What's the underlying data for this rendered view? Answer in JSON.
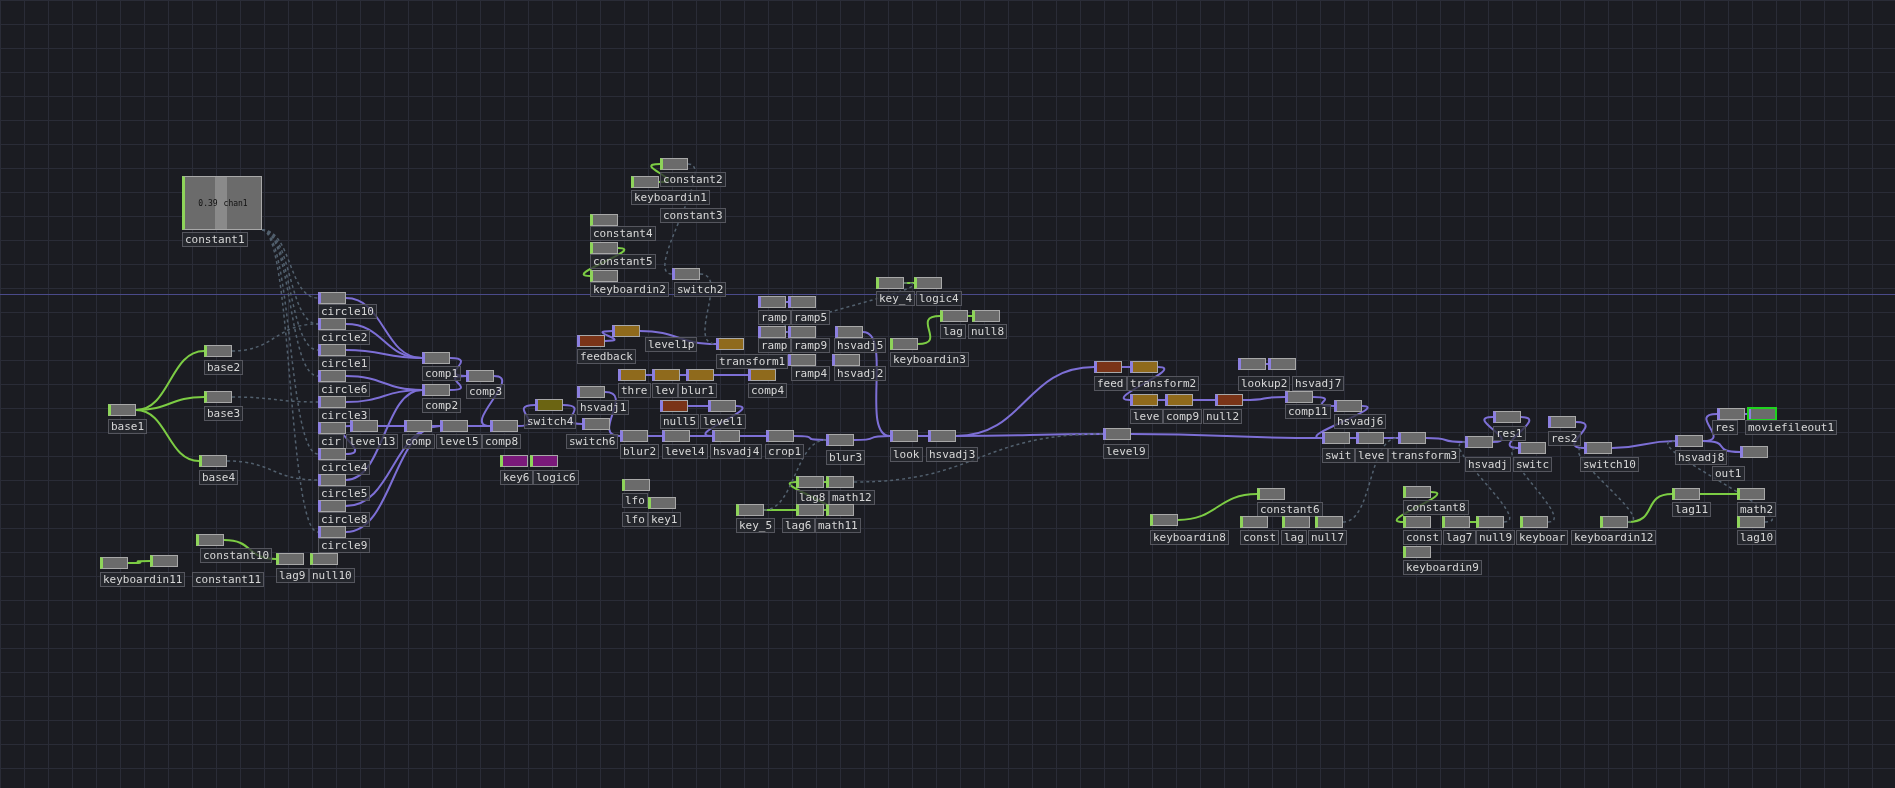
{
  "network": {
    "viewer": {
      "value": "0.39",
      "channel": "chan1"
    },
    "nodes": [
      {
        "label": "constant1",
        "kind": "viewer",
        "color": "#6b6b6b",
        "selected": false
      },
      {
        "label": "base2",
        "kind": "chop",
        "color": "#6b6b6b",
        "selected": false
      },
      {
        "label": "base3",
        "kind": "chop",
        "color": "#6b6b6b",
        "selected": false
      },
      {
        "label": "base1",
        "kind": "chop",
        "color": "#6b6b6b",
        "selected": false
      },
      {
        "label": "base4",
        "kind": "chop",
        "color": "#6b6b6b",
        "selected": false
      },
      {
        "label": "circle10",
        "kind": "top",
        "color": "#6b6b6b",
        "selected": false
      },
      {
        "label": "circle2",
        "kind": "top",
        "color": "#6b6b6b",
        "selected": false
      },
      {
        "label": "circle1",
        "kind": "top",
        "color": "#6b6b6b",
        "selected": false
      },
      {
        "label": "circle6",
        "kind": "top",
        "color": "#6b6b6b",
        "selected": false
      },
      {
        "label": "circle3",
        "kind": "top",
        "color": "#6b6b6b",
        "selected": false
      },
      {
        "label": "cir",
        "kind": "top",
        "color": "#6b6b6b",
        "selected": false
      },
      {
        "label": "circle4",
        "kind": "top",
        "color": "#6b6b6b",
        "selected": false
      },
      {
        "label": "circle5",
        "kind": "top",
        "color": "#6b6b6b",
        "selected": false
      },
      {
        "label": "circle8",
        "kind": "top",
        "color": "#6b6b6b",
        "selected": false
      },
      {
        "label": "circle9",
        "kind": "top",
        "color": "#6b6b6b",
        "selected": false
      },
      {
        "label": "comp1",
        "kind": "top",
        "color": "#6b6b6b",
        "selected": false
      },
      {
        "label": "comp3",
        "kind": "top",
        "color": "#6b6b6b",
        "selected": false
      },
      {
        "label": "comp2",
        "kind": "top",
        "color": "#6b6b6b",
        "selected": false
      },
      {
        "label": "level13",
        "kind": "top",
        "color": "#6b6b6b",
        "selected": false
      },
      {
        "label": "comp",
        "kind": "top",
        "color": "#6b6b6b",
        "selected": false
      },
      {
        "label": "level5",
        "kind": "top",
        "color": "#6b6b6b",
        "selected": false
      },
      {
        "label": "comp8",
        "kind": "top",
        "color": "#6b6b6b",
        "selected": false
      },
      {
        "label": "switch4",
        "kind": "top",
        "color": "#6b6412",
        "selected": false
      },
      {
        "label": "switch6",
        "kind": "top",
        "color": "#6b6b6b",
        "selected": false
      },
      {
        "label": "key6",
        "kind": "chop",
        "color": "#7a1a7a",
        "selected": false
      },
      {
        "label": "logic6",
        "kind": "chop",
        "color": "#7a1a7a",
        "selected": false
      },
      {
        "label": "keyboardin11",
        "kind": "chop",
        "color": "#6b6b6b",
        "selected": false
      },
      {
        "label": "constant10",
        "kind": "chop",
        "color": "#6b6b6b",
        "selected": false
      },
      {
        "label": "constant11",
        "kind": "chop",
        "color": "#6b6b6b",
        "selected": false
      },
      {
        "label": "lag9",
        "kind": "chop",
        "color": "#6b6b6b",
        "selected": false
      },
      {
        "label": "null10",
        "kind": "chop",
        "color": "#6b6b6b",
        "selected": false
      },
      {
        "label": "constant2",
        "kind": "chop",
        "color": "#6b6b6b",
        "selected": false
      },
      {
        "label": "keyboardin1",
        "kind": "chop",
        "color": "#6b6b6b",
        "selected": false
      },
      {
        "label": "constant3",
        "kind": "label",
        "selected": false
      },
      {
        "label": "constant4",
        "kind": "chop",
        "color": "#6b6b6b",
        "selected": false
      },
      {
        "label": "constant5",
        "kind": "chop",
        "color": "#6b6b6b",
        "selected": false
      },
      {
        "label": "keyboardin2",
        "kind": "chop",
        "color": "#6b6b6b",
        "selected": false
      },
      {
        "label": "switch2",
        "kind": "top",
        "color": "#6b6b6b",
        "selected": false
      },
      {
        "label": "key_4",
        "kind": "chop",
        "color": "#6b6b6b",
        "selected": false
      },
      {
        "label": "logic4",
        "kind": "chop",
        "color": "#6b6b6b",
        "selected": false
      },
      {
        "label": "lag",
        "kind": "chop",
        "color": "#6b6b6b",
        "selected": false
      },
      {
        "label": "null8",
        "kind": "chop",
        "color": "#6b6b6b",
        "selected": false
      },
      {
        "label": "keyboardin3",
        "kind": "chop",
        "color": "#6b6b6b",
        "selected": false
      },
      {
        "label": "ramp",
        "kind": "top",
        "color": "#6b6b6b",
        "selected": false
      },
      {
        "label": "ramp5",
        "kind": "top",
        "color": "#6b6b6b",
        "selected": false
      },
      {
        "label": "ramp",
        "kind": "top",
        "color": "#6b6b6b",
        "selected": false
      },
      {
        "label": "ramp9",
        "kind": "top",
        "color": "#6b6b6b",
        "selected": false
      },
      {
        "label": "hsvadj5",
        "kind": "top",
        "color": "#6b6b6b",
        "selected": false
      },
      {
        "label": "ramp4",
        "kind": "top",
        "color": "#6b6b6b",
        "selected": false
      },
      {
        "label": "hsvadj2",
        "kind": "top",
        "color": "#6b6b6b",
        "selected": false
      },
      {
        "label": "transform1",
        "kind": "top",
        "color": "#8f6a1c",
        "selected": false
      },
      {
        "label": "feedback",
        "kind": "top",
        "color": "#7a3418",
        "selected": false
      },
      {
        "label": "level1p",
        "kind": "top",
        "color": "#8f6a1c",
        "selected": false
      },
      {
        "label": "thre",
        "kind": "top",
        "color": "#8f6a1c",
        "selected": false
      },
      {
        "label": "lev",
        "kind": "top",
        "color": "#8f6a1c",
        "selected": false
      },
      {
        "label": "blur1",
        "kind": "top",
        "color": "#8f6a1c",
        "selected": false
      },
      {
        "label": "comp4",
        "kind": "top",
        "color": "#8f6a1c",
        "selected": false
      },
      {
        "label": "hsvadj1",
        "kind": "top",
        "color": "#6b6b6b",
        "selected": false
      },
      {
        "label": "null5",
        "kind": "top",
        "color": "#7a3418",
        "selected": false
      },
      {
        "label": "level1",
        "kind": "top",
        "color": "#6b6b6b",
        "selected": false
      },
      {
        "label": "blur2",
        "kind": "top",
        "color": "#6b6b6b",
        "selected": false
      },
      {
        "label": "level4",
        "kind": "top",
        "color": "#6b6b6b",
        "selected": false
      },
      {
        "label": "hsvadj4",
        "kind": "top",
        "color": "#6b6b6b",
        "selected": false
      },
      {
        "label": "crop1",
        "kind": "top",
        "color": "#6b6b6b",
        "selected": false
      },
      {
        "label": "blur3",
        "kind": "top",
        "color": "#6b6b6b",
        "selected": false
      },
      {
        "label": "look",
        "kind": "top",
        "color": "#6b6b6b",
        "selected": false
      },
      {
        "label": "hsvadj3",
        "kind": "top",
        "color": "#6b6b6b",
        "selected": false
      },
      {
        "label": "level9",
        "kind": "top",
        "color": "#6b6b6b",
        "selected": false
      },
      {
        "label": "lfo",
        "kind": "chop",
        "color": "#6b6b6b",
        "selected": false
      },
      {
        "label": "lfo",
        "kind": "label",
        "selected": false
      },
      {
        "label": "key1",
        "kind": "chop",
        "color": "#6b6b6b",
        "selected": false
      },
      {
        "label": "lag8",
        "kind": "chop",
        "color": "#6b6b6b",
        "selected": false
      },
      {
        "label": "math12",
        "kind": "chop",
        "color": "#6b6b6b",
        "selected": false
      },
      {
        "label": "key_5",
        "kind": "chop",
        "color": "#6b6b6b",
        "selected": false
      },
      {
        "label": "lag6",
        "kind": "chop",
        "color": "#6b6b6b",
        "selected": false
      },
      {
        "label": "math11",
        "kind": "chop",
        "color": "#6b6b6b",
        "selected": false
      },
      {
        "label": "feed",
        "kind": "top",
        "color": "#7a3418",
        "selected": false
      },
      {
        "label": "transform2",
        "kind": "top",
        "color": "#8f6a1c",
        "selected": false
      },
      {
        "label": "lookup2",
        "kind": "top",
        "color": "#6b6b6b",
        "selected": false
      },
      {
        "label": "hsvadj7",
        "kind": "top",
        "color": "#6b6b6b",
        "selected": false
      },
      {
        "label": "leve",
        "kind": "top",
        "color": "#8f6a1c",
        "selected": false
      },
      {
        "label": "comp9",
        "kind": "top",
        "color": "#8f6a1c",
        "selected": false
      },
      {
        "label": "null2",
        "kind": "top",
        "color": "#7a3418",
        "selected": false
      },
      {
        "label": "comp11",
        "kind": "top",
        "color": "#6b6b6b",
        "selected": false
      },
      {
        "label": "hsvadj6",
        "kind": "top",
        "color": "#6b6b6b",
        "selected": false
      },
      {
        "label": "swit",
        "kind": "top",
        "color": "#6b6b6b",
        "selected": false
      },
      {
        "label": "leve",
        "kind": "top",
        "color": "#6b6b6b",
        "selected": false
      },
      {
        "label": "transform3",
        "kind": "top",
        "color": "#6b6b6b",
        "selected": false
      },
      {
        "label": "res1",
        "kind": "top",
        "color": "#6b6b6b",
        "selected": false
      },
      {
        "label": "hsvadj",
        "kind": "top",
        "color": "#6b6b6b",
        "selected": false
      },
      {
        "label": "res2",
        "kind": "top",
        "color": "#6b6b6b",
        "selected": false
      },
      {
        "label": "switc",
        "kind": "top",
        "color": "#6b6b6b",
        "selected": false
      },
      {
        "label": "switch10",
        "kind": "top",
        "color": "#6b6b6b",
        "selected": false
      },
      {
        "label": "hsvadj8",
        "kind": "top",
        "color": "#6b6b6b",
        "selected": false
      },
      {
        "label": "res",
        "kind": "top",
        "color": "#6b6b6b",
        "selected": false
      },
      {
        "label": "out1",
        "kind": "top",
        "color": "#6b6b6b",
        "selected": false
      },
      {
        "label": "moviefileout1",
        "kind": "top",
        "color": "#6b6b6b",
        "selected": true
      },
      {
        "label": "keyboardin8",
        "kind": "chop",
        "color": "#6b6b6b",
        "selected": false
      },
      {
        "label": "constant6",
        "kind": "chop",
        "color": "#6b6b6b",
        "selected": false
      },
      {
        "label": "const",
        "kind": "chop",
        "color": "#6b6b6b",
        "selected": false
      },
      {
        "label": "lag",
        "kind": "chop",
        "color": "#6b6b6b",
        "selected": false
      },
      {
        "label": "null7",
        "kind": "chop",
        "color": "#6b6b6b",
        "selected": false
      },
      {
        "label": "constant8",
        "kind": "chop",
        "color": "#6b6b6b",
        "selected": false
      },
      {
        "label": "const",
        "kind": "chop",
        "color": "#6b6b6b",
        "selected": false
      },
      {
        "label": "lag7",
        "kind": "chop",
        "color": "#6b6b6b",
        "selected": false
      },
      {
        "label": "null9",
        "kind": "chop",
        "color": "#6b6b6b",
        "selected": false
      },
      {
        "label": "keyboardin9",
        "kind": "chop",
        "color": "#6b6b6b",
        "selected": false
      },
      {
        "label": "keyboar",
        "kind": "chop",
        "color": "#6b6b6b",
        "selected": false
      },
      {
        "label": "keyboardin12",
        "kind": "chop",
        "color": "#6b6b6b",
        "selected": false
      },
      {
        "label": "lag11",
        "kind": "chop",
        "color": "#6b6b6b",
        "selected": false
      },
      {
        "label": "math2",
        "kind": "chop",
        "color": "#6b6b6b",
        "selected": false
      },
      {
        "label": "lag10",
        "kind": "chop",
        "color": "#6b6b6b",
        "selected": false
      }
    ]
  }
}
